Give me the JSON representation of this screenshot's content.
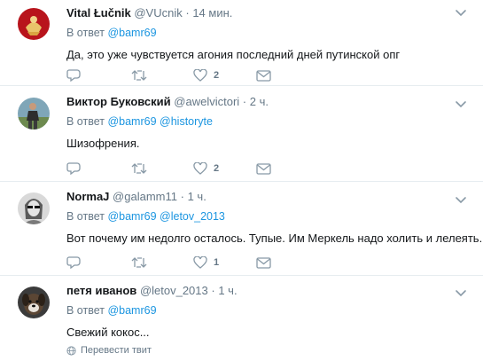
{
  "tweets": [
    {
      "name": "Vital Łučnik",
      "handle": "@VUcnik",
      "dot": "·",
      "time": "14 мин.",
      "reply_prefix": "В ответ",
      "mentions": [
        "@bamr69"
      ],
      "text": "Да, это уже чувствуется агония последний дней путинской опг",
      "likes": "2",
      "avatar": "coat-of-arms"
    },
    {
      "name": "Виктор Буковский",
      "handle": "@awelvictori",
      "dot": "·",
      "time": "2 ч.",
      "reply_prefix": "В ответ",
      "mentions": [
        "@bamr69",
        "@historyte"
      ],
      "text": "Шизофрения.",
      "likes": "2",
      "avatar": "person-outdoors"
    },
    {
      "name": "NormaJ",
      "handle": "@galamm11",
      "dot": "·",
      "time": "1 ч.",
      "reply_prefix": "В ответ",
      "mentions": [
        "@bamr69",
        "@letov_2013"
      ],
      "text": "Вот почему им недолго осталось. Тупые. Им Меркель надо холить и лелеять.",
      "likes": "1",
      "avatar": "person-sunglasses"
    },
    {
      "name": "петя иванов",
      "handle": "@letov_2013",
      "dot": "·",
      "time": "1 ч.",
      "reply_prefix": "В ответ",
      "mentions": [
        "@bamr69"
      ],
      "text": "Свежий кокос...",
      "likes": "",
      "avatar": "dog"
    }
  ],
  "translate_label": "Перевести твит",
  "colors": {
    "accent": "#1b95e0",
    "secondary_text": "#657786",
    "icon": "#8899a6",
    "border": "#e6ecf0"
  }
}
